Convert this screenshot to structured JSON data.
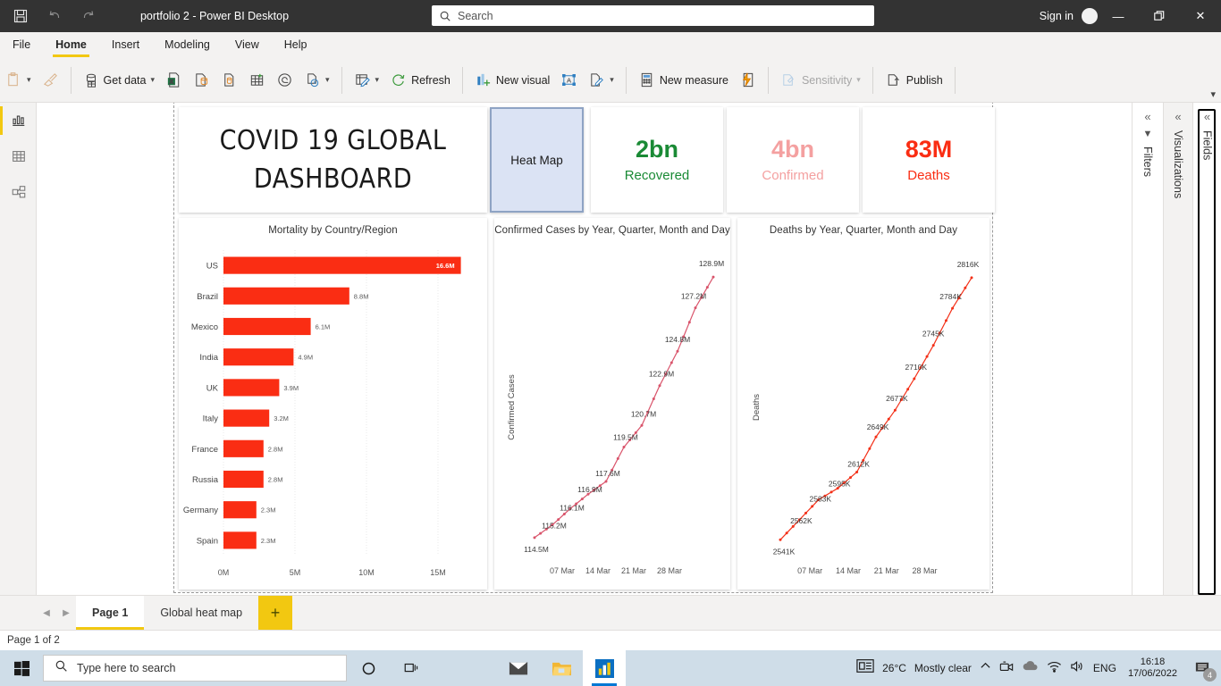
{
  "titlebar": {
    "title": "portfolio 2 - Power BI Desktop",
    "search_placeholder": "Search",
    "signin": "Sign in",
    "save_icon": "save-icon",
    "undo_icon": "undo-icon",
    "redo_icon": "redo-icon",
    "minimize": "—",
    "maximize": "❐",
    "close": "✕"
  },
  "menubar": {
    "items": [
      {
        "label": "File",
        "active": false
      },
      {
        "label": "Home",
        "active": true
      },
      {
        "label": "Insert",
        "active": false
      },
      {
        "label": "Modeling",
        "active": false
      },
      {
        "label": "View",
        "active": false
      },
      {
        "label": "Help",
        "active": false
      }
    ]
  },
  "ribbon": {
    "paste_label": "",
    "format_painter": "",
    "get_data": "Get data",
    "excel": "",
    "sql_server": "",
    "enter_data": "",
    "dataverse": "",
    "recent_sources": "",
    "transform_data": "",
    "refresh": "Refresh",
    "new_visual": "New visual",
    "text_box": "",
    "more_visuals": "",
    "new_measure": "New measure",
    "quick_measure": "",
    "sensitivity": "Sensitivity",
    "publish": "Publish",
    "collapse_icon": "chevron-down-icon"
  },
  "leftrail": {
    "items": [
      {
        "name": "report-view",
        "icon": "report-chart-icon",
        "active": true
      },
      {
        "name": "data-view",
        "icon": "table-grid-icon",
        "active": false
      },
      {
        "name": "model-view",
        "icon": "model-relationship-icon",
        "active": false
      }
    ]
  },
  "report": {
    "dashboard_title_line1": "COVID 19  GLOBAL",
    "dashboard_title_line2": "DASHBOARD",
    "heatmap_button": "Heat Map",
    "kpis": [
      {
        "value": "2bn",
        "label": "Recovered",
        "color": "#1a8a35"
      },
      {
        "value": "4bn",
        "label": "Confirmed",
        "color": "#f4a0a0"
      },
      {
        "value": "83M",
        "label": "Deaths",
        "color": "#fa2d13"
      }
    ]
  },
  "chart_data": [
    {
      "type": "bar",
      "title": "Mortality by Country/Region",
      "orientation": "horizontal",
      "xlabel": "",
      "ylabel": "",
      "categories": [
        "US",
        "Brazil",
        "Mexico",
        "India",
        "UK",
        "Italy",
        "France",
        "Russia",
        "Germany",
        "Spain"
      ],
      "values": [
        16.6,
        8.8,
        6.1,
        4.9,
        3.9,
        3.2,
        2.8,
        2.8,
        2.3,
        2.3
      ],
      "value_labels": [
        "16.6M",
        "8.8M",
        "6.1M",
        "4.9M",
        "3.9M",
        "3.2M",
        "2.8M",
        "2.8M",
        "2.3M",
        "2.3M"
      ],
      "xticks": [
        "0M",
        "5M",
        "10M",
        "15M"
      ],
      "xlim": [
        0,
        17.5
      ],
      "bar_color": "#fa2d13",
      "grid": true,
      "legend": "none"
    },
    {
      "type": "line",
      "title": "Confirmed Cases by Year, Quarter, Month and Day",
      "ylabel": "Confirmed Cases",
      "xlabel": "",
      "xticks": [
        "07 Mar",
        "14 Mar",
        "21 Mar",
        "28 Mar"
      ],
      "point_labels": [
        "114.5M",
        "115.2M",
        "116.1M",
        "116.9M",
        "117.6M",
        "119.5M",
        "120.7M",
        "122.9M",
        "124.8M",
        "127.2M",
        "128.9M"
      ],
      "values": [
        114.5,
        115.2,
        116.1,
        116.9,
        117.6,
        119.5,
        120.7,
        122.9,
        124.8,
        127.2,
        128.9
      ],
      "ylim": [
        113.8,
        129.6
      ],
      "line_color": "#d9546b",
      "grid": false,
      "legend": "none"
    },
    {
      "type": "line",
      "title": "Deaths by Year, Quarter, Month and Day",
      "ylabel": "Deaths",
      "xlabel": "",
      "xticks": [
        "07 Mar",
        "14 Mar",
        "21 Mar",
        "28 Mar"
      ],
      "point_labels": [
        "2541K",
        "2562K",
        "2583K",
        "2595K",
        "2612K",
        "2649K",
        "2677K",
        "2710K",
        "2745K",
        "2784K",
        "2816K"
      ],
      "values": [
        2541,
        2562,
        2583,
        2595,
        2612,
        2649,
        2677,
        2710,
        2745,
        2784,
        2816
      ],
      "ylim": [
        2530,
        2830
      ],
      "line_color": "#f33018",
      "grid": false,
      "legend": "none"
    }
  ],
  "panes": {
    "filters": "Filters",
    "visualizations": "Visualizations",
    "fields": "Fields",
    "collapse_icon": "chevron-double-left-icon",
    "filter_icon": "funnel-icon"
  },
  "pagetabs": {
    "prev": "◀",
    "next": "▶",
    "tabs": [
      {
        "label": "Page 1",
        "active": true
      },
      {
        "label": "Global heat map",
        "active": false
      }
    ],
    "add": "+"
  },
  "statusbar": {
    "text": "Page 1 of 2"
  },
  "taskbar": {
    "search_placeholder": "Type here to search",
    "cortana_icon": "cortana-circle-icon",
    "taskview_icon": "task-view-icon",
    "apps": [
      {
        "name": "mail-icon",
        "active": false
      },
      {
        "name": "file-explorer-icon",
        "active": false
      },
      {
        "name": "power-bi-icon",
        "active": true
      }
    ],
    "weather_temp": "26°C",
    "weather_desc": "Mostly clear",
    "language": "ENG",
    "time": "16:18",
    "date": "17/06/2022",
    "notification_count": "4"
  }
}
